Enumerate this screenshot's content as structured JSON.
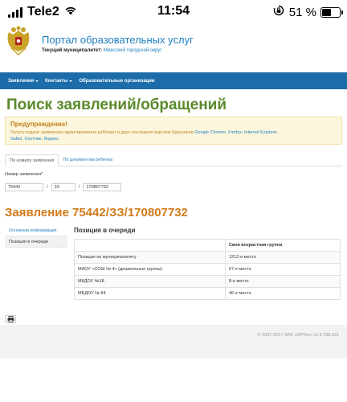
{
  "status_bar": {
    "carrier": "Tele2",
    "time": "11:54",
    "battery_percent": "51 %",
    "battery_level": 0.51
  },
  "header": {
    "portal_title": "Портал образовательных услуг",
    "municipality_label": "Текущий муниципалитет:",
    "municipality_value": "Миасский городской округ"
  },
  "nav": {
    "items": [
      {
        "label": "Заявления",
        "has_dropdown": true
      },
      {
        "label": "Контакты",
        "has_dropdown": true
      },
      {
        "label": "Образовательные организации",
        "has_dropdown": false
      }
    ]
  },
  "page": {
    "title": "Поиск заявлений/обращений"
  },
  "alert": {
    "title": "Предупреждение!",
    "text_before": "Услуга подачи заявления гарантированно работает в двух последних версиях браузеров ",
    "browsers": [
      "Google Chrome",
      "Firefox",
      "Internet Explorer",
      "Safari",
      "Спутник",
      "Яндекс."
    ]
  },
  "search_tabs": [
    {
      "label": "По номеру заявления",
      "active": true
    },
    {
      "label": "По документам ребенка",
      "active": false
    }
  ],
  "search": {
    "label": "Номер заявления*",
    "part1": "75442",
    "part2": "33",
    "part3": "170807732",
    "separator": "/"
  },
  "application": {
    "title": "Заявление 75442/ЗЗ/170807732"
  },
  "side_nav": [
    {
      "label": "Основная информация",
      "active": false
    },
    {
      "label": "Позиция в очереди",
      "active": true
    }
  ],
  "queue": {
    "title": "Позиция в очереди",
    "header": [
      "",
      "Своя возрастная группа"
    ],
    "rows": [
      [
        "Позиция по муниципалитету",
        "1212-е место"
      ],
      [
        "МАОУ «СОШ № 4» (дошкольные группы)",
        "67-е место"
      ],
      [
        "МКДОУ №18",
        "8-е место"
      ],
      [
        "МБДОУ № 84",
        "46-е место"
      ]
    ]
  },
  "footer": {
    "copyright": "© 2007-2017 ЗАО «ИРТех» v1.6.708.321"
  }
}
